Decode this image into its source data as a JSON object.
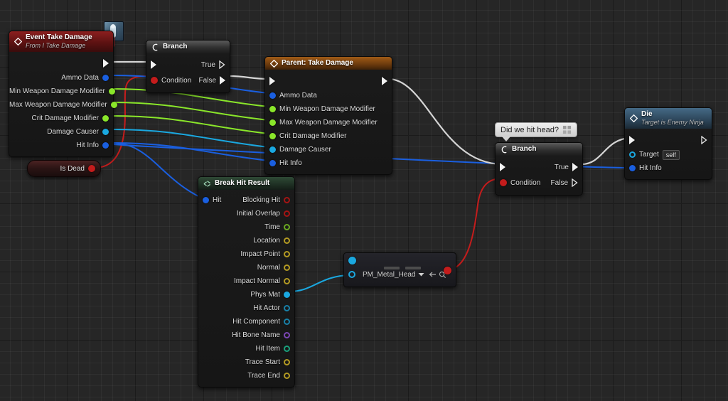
{
  "app": {
    "title": "Unreal Engine Blueprint Event Graph",
    "canvas_bg": "#262626",
    "grid_minor": "#3a3a3a",
    "grid_major": "#0f0f0f"
  },
  "pin_colors": {
    "exec": "#ffffff",
    "bool": "#c91d1d",
    "float": "#8ae62a",
    "struct": "#1a5fe0",
    "object": "#1aa8e0",
    "string": "#e02aa8",
    "name": "#9b5ce0",
    "int": "#21cfa0",
    "vector": "#e0c72a"
  },
  "wire_colors": {
    "exec": "#d5d5d5",
    "bool": "#c41c1c",
    "float": "#8ae62a",
    "struct": "#1a5fe0",
    "object": "#1aa8e0"
  },
  "nodes": {
    "event_take_damage": {
      "title": "Event Take Damage",
      "subtitle": "From I Take Damage",
      "header_color": "#5d1212",
      "icon": "event-diamond-icon",
      "thumbnail": "character-thumbnail-icon",
      "delegate_pin": "delegate-output-pin",
      "out_exec": "",
      "outputs": [
        {
          "label": "Ammo Data",
          "type": "struct"
        },
        {
          "label": "Min Weapon Damage Modifier",
          "type": "float"
        },
        {
          "label": "Max Weapon Damage Modifier",
          "type": "float"
        },
        {
          "label": "Crit Damage Modifier",
          "type": "float"
        },
        {
          "label": "Damage Causer",
          "type": "object"
        },
        {
          "label": "Hit Info",
          "type": "struct"
        }
      ]
    },
    "is_dead": {
      "label": "Is Dead",
      "type": "bool",
      "header_color": "#2a1414"
    },
    "branch_1": {
      "title": "Branch",
      "header_color": "#2d2d2d",
      "icon": "branch-icon",
      "in_exec": "",
      "condition_label": "Condition",
      "true_label": "True",
      "false_label": "False"
    },
    "parent_take_damage": {
      "title": "Parent: Take Damage",
      "header_color": "#6b3a0d",
      "icon": "event-diamond-icon",
      "inputs": [
        {
          "label": "Ammo Data",
          "type": "struct"
        },
        {
          "label": "Min Weapon Damage Modifier",
          "type": "float"
        },
        {
          "label": "Max Weapon Damage Modifier",
          "type": "float"
        },
        {
          "label": "Crit Damage Modifier",
          "type": "float"
        },
        {
          "label": "Damage Causer",
          "type": "object"
        },
        {
          "label": "Hit Info",
          "type": "struct"
        }
      ]
    },
    "break_hit_result": {
      "title": "Break Hit Result",
      "header_color": "#1e2f23",
      "icon": "break-struct-icon",
      "input": {
        "label": "Hit",
        "type": "struct"
      },
      "outputs": [
        {
          "label": "Blocking Hit",
          "type": "bool"
        },
        {
          "label": "Initial Overlap",
          "type": "bool"
        },
        {
          "label": "Time",
          "type": "float"
        },
        {
          "label": "Location",
          "type": "vector"
        },
        {
          "label": "Impact Point",
          "type": "vector"
        },
        {
          "label": "Normal",
          "type": "vector"
        },
        {
          "label": "Impact Normal",
          "type": "vector"
        },
        {
          "label": "Phys Mat",
          "type": "object"
        },
        {
          "label": "Hit Actor",
          "type": "object"
        },
        {
          "label": "Hit Component",
          "type": "object"
        },
        {
          "label": "Hit Bone Name",
          "type": "name"
        },
        {
          "label": "Hit Item",
          "type": "int"
        },
        {
          "label": "Trace Start",
          "type": "vector"
        },
        {
          "label": "Trace End",
          "type": "vector"
        }
      ]
    },
    "equal_enum": {
      "enum_value": "PM_Metal_Head",
      "in_object_type": "object",
      "in_enum_type": "object",
      "out_type": "bool",
      "dropdown_icon": "chevron-down-icon",
      "reset_icon": "reset-arrow-icon",
      "browse_icon": "browse-magnifier-icon"
    },
    "comment_bubble": {
      "text": "Did we hit head?",
      "pin_icon": "pin-comment-icon"
    },
    "branch_2": {
      "title": "Branch",
      "header_color": "#2d2d2d",
      "icon": "branch-icon",
      "condition_label": "Condition",
      "true_label": "True",
      "false_label": "False"
    },
    "die": {
      "title": "Die",
      "subtitle": "Target is Enemy Ninja",
      "header_color": "#2c4458",
      "icon": "function-diamond-icon",
      "inputs": [
        {
          "label": "Target",
          "type": "object",
          "value": "self"
        },
        {
          "label": "Hit Info",
          "type": "struct",
          "value": ""
        }
      ]
    }
  }
}
